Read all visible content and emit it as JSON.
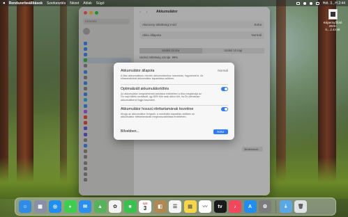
{
  "menubar": {
    "apple_icon": "apple-logo-icon",
    "app_name": "Rendszerbeállítások",
    "items": [
      "Szerkesztés",
      "Nézet",
      "Ablak",
      "Súgó"
    ],
    "clock": "Hét. 3., H 2:44"
  },
  "desktop_file": {
    "name": "Képernyőfotó",
    "sub": "2025-0....2.43.48"
  },
  "window": {
    "title": "Akkumulátor",
    "subtitle": "",
    "search_placeholder": "Keresés",
    "user_name": "",
    "rows": {
      "row1_label": "Alacsony töltöttségi mód",
      "row1_value": "Soha",
      "row2_label": "Akku állapota",
      "row2_value": "Normál",
      "seg_left": "Utolsó 24 óra",
      "seg_right": "Utolsó 10 nap",
      "last_charge": "Utolsó töltöttség szintje: 98%"
    },
    "options_button": "Beállítások..."
  },
  "modal": {
    "battery_health": {
      "title": "Akkumulátor állapota",
      "status": "Normál",
      "desc": "A Mac akkumulátora, minden akkumulátorhoz hasonlóan, fogyóeszköz. Az elhasználódott akkumulátor kapacitása csökken."
    },
    "optimized_charging": {
      "title": "Optimalizált akkumulátortöltés",
      "desc": "Az akkumulátor öregedésének lassítása érdekében a Mac megtanulja az Ön napi töltési szokásait, így 80% fölé csak akkor tölt, ha Ön várhatóan akkumulátorról fogja használni.",
      "enabled": true
    },
    "lifespan_management": {
      "title": "Akkumulátor hosszú élettartamának kezelése",
      "desc": "Ahogy az akkumulátor öregszik, a maximális kapacitás csökken az akkumulátor élettartamának meghosszabbítása érdekében.",
      "enabled": true
    },
    "more_button": "Bővebben...",
    "ok_button": "Kész"
  },
  "dock": {
    "items": [
      {
        "name": "finder-icon",
        "glyph": "☺",
        "color": "#2f8be6"
      },
      {
        "name": "launchpad-icon",
        "glyph": "▦",
        "color": "#8a8ea8"
      },
      {
        "name": "safari-icon",
        "glyph": "◎",
        "color": "#1f8ef0"
      },
      {
        "name": "messages-icon",
        "glyph": "●",
        "color": "#3ccf4e"
      },
      {
        "name": "mail-icon",
        "glyph": "✉",
        "color": "#2b8ff2"
      },
      {
        "name": "maps-icon",
        "glyph": "▲",
        "color": "#56b35a"
      },
      {
        "name": "photos-icon",
        "glyph": "✿",
        "color": "#f3f3f3"
      },
      {
        "name": "facetime-icon",
        "glyph": "■",
        "color": "#37c24d"
      },
      {
        "name": "calendar-icon",
        "glyph": "3",
        "color": "#ffffff"
      },
      {
        "name": "finder-folder-icon",
        "glyph": "◧",
        "color": "#b08850"
      },
      {
        "name": "reminders-icon",
        "glyph": "☰",
        "color": "#f5f5f5"
      },
      {
        "name": "notes-icon",
        "glyph": "▤",
        "color": "#f7d64a"
      },
      {
        "name": "freeform-icon",
        "glyph": "〰",
        "color": "#ffffff"
      },
      {
        "name": "tv-icon",
        "glyph": "tv",
        "color": "#1a1a1a"
      },
      {
        "name": "music-icon",
        "glyph": "♪",
        "color": "#f3475e"
      },
      {
        "name": "app-store-icon",
        "glyph": "A",
        "color": "#1f8ef0"
      },
      {
        "name": "system-settings-icon",
        "glyph": "⚙",
        "color": "#7c7c7c"
      },
      {
        "name": "downloads-folder-icon",
        "glyph": "⤓",
        "color": "#5aa7e8"
      },
      {
        "name": "trash-icon",
        "glyph": "🗑",
        "color": "#dfe3e6"
      }
    ],
    "calendar_month": "SZE",
    "calendar_day": "3"
  }
}
